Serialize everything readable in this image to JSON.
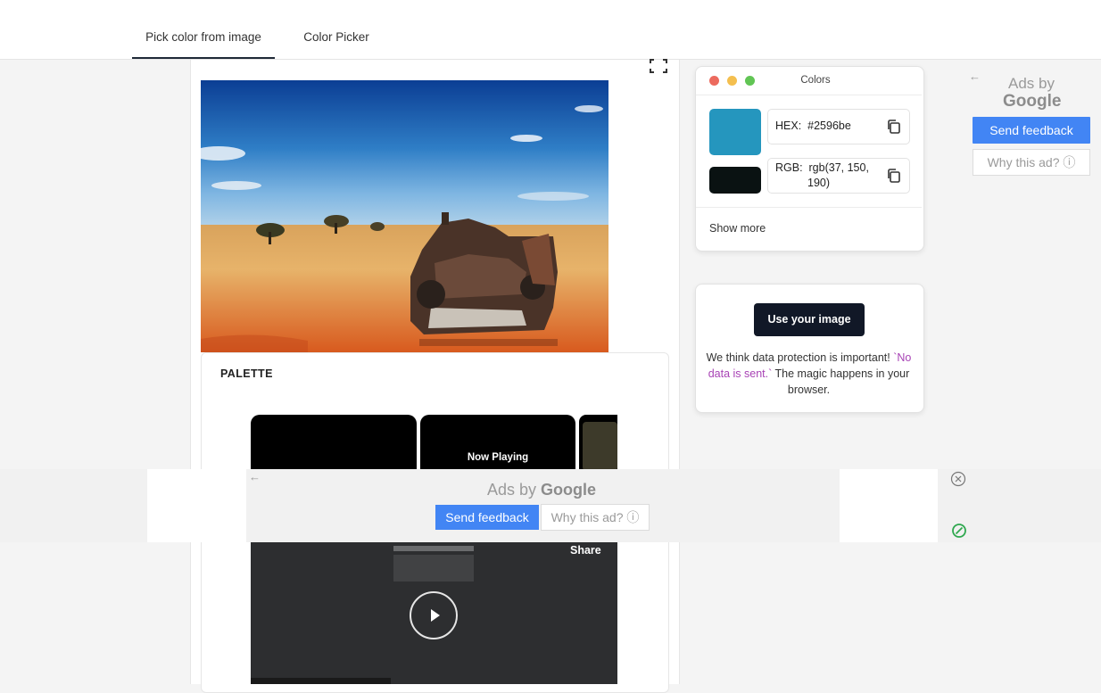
{
  "tabs": [
    {
      "label": "Pick color from image",
      "active": true
    },
    {
      "label": "Color Picker",
      "active": false
    }
  ],
  "palette": {
    "title": "PALETTE",
    "thumb_label": "Now Playing"
  },
  "colors_panel": {
    "title": "Colors",
    "window_dots": [
      "#ec6a5e",
      "#f4bf4f",
      "#61c554"
    ],
    "primary": {
      "swatch": "#2596be",
      "label": "HEX:",
      "value": "#2596be"
    },
    "secondary": {
      "swatch": "#0a1212",
      "label": "RGB:",
      "value_line1": "rgb(37, 150,",
      "value_line2": "190)"
    },
    "show_more": "Show more"
  },
  "use_image": {
    "button": "Use your image",
    "text_1": "We think data protection is important! ",
    "text_code": "`No data is sent.`",
    "text_2": " The magic happens in your browser."
  },
  "ad_right": {
    "ads_by": "Ads by",
    "brand": "Google",
    "send_feedback": "Send feedback",
    "why_ad": "Why this ad? ⓘ"
  },
  "ad_bottom": {
    "ads_by": "Ads by ",
    "brand": "Google",
    "send_feedback": "Send feedback",
    "why_ad": "Why this ad? ⓘ"
  },
  "video": {
    "share": "Share"
  }
}
